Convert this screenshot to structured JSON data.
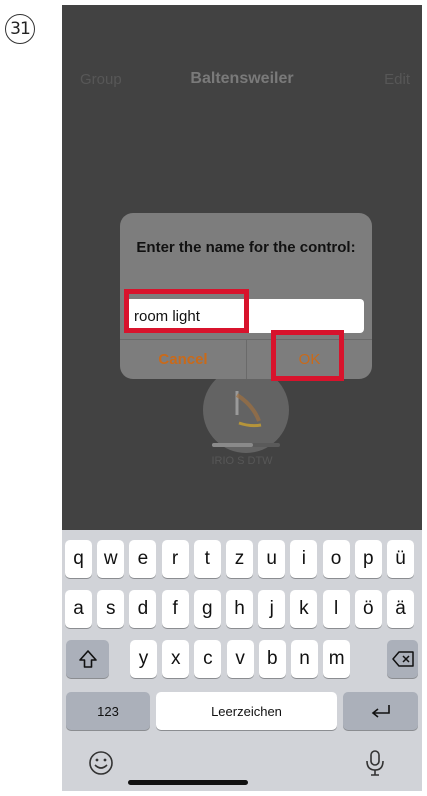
{
  "step": "31",
  "navbar": {
    "left": "Group",
    "title": "Baltensweiler",
    "right": "Edit"
  },
  "device": {
    "name": "IRIO S DTW",
    "level": 0.6
  },
  "dialog": {
    "title": "Enter the name for the control:",
    "input_value": "room light",
    "cancel": "Cancel",
    "ok": "OK"
  },
  "highlight_color": "#d8132c",
  "accent_color": "#c96a1a",
  "keyboard": {
    "row1": [
      "q",
      "w",
      "e",
      "r",
      "t",
      "z",
      "u",
      "i",
      "o",
      "p",
      "ü"
    ],
    "row2": [
      "a",
      "s",
      "d",
      "f",
      "g",
      "h",
      "j",
      "k",
      "l",
      "ö",
      "ä"
    ],
    "row3": [
      "y",
      "x",
      "c",
      "v",
      "b",
      "n",
      "m"
    ],
    "numbers": "123",
    "space": "Leerzeichen",
    "icons": {
      "shift": "shift-icon",
      "backspace": "backspace-icon",
      "return": "return-icon",
      "emoji": "emoji-icon",
      "mic": "microphone-icon"
    }
  }
}
